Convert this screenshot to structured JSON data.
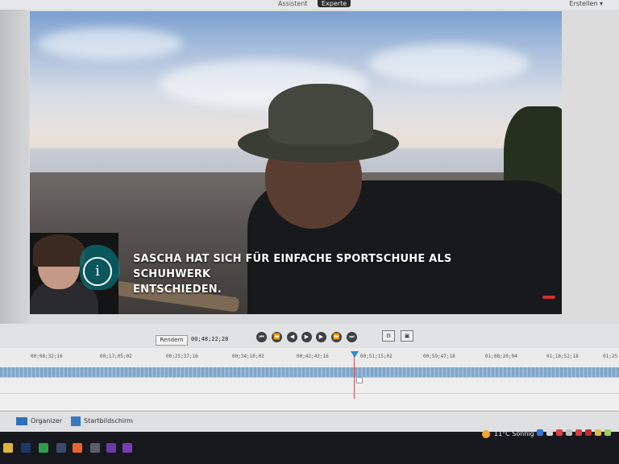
{
  "topbar": {
    "mode_quick": "Assistent",
    "mode_expert": "Experte",
    "create_label": "Erstellen ▾"
  },
  "preview": {
    "subtitle_line1": "SASCHA HAT SICH FÜR EINFACHE SPORTSCHUHE ALS SCHUHWERK",
    "subtitle_line2": "ENTSCHIEDEN.",
    "info_glyph": "i"
  },
  "transport": {
    "render_label": "Rendern",
    "timecode": "00;48;22;28",
    "buttons": [
      "⏮",
      "⏪",
      "◀",
      "▶",
      "▶",
      "⏩",
      "⏭"
    ],
    "aux_buttons": [
      "⚙",
      "▣"
    ]
  },
  "timeline": {
    "ruler_labels": [
      "00;08;32;16",
      "00;17;05;02",
      "00;25;37;16",
      "00;34;10;02",
      "00;42;42;16",
      "00;51;15;02",
      "00;59;47;18",
      "01;08;20;04",
      "01;16;52;18",
      "01;25"
    ]
  },
  "appbar": {
    "organizer_label": "Organizer",
    "home_label": "Startbildschirm"
  },
  "taskbar": {
    "weather_text": "11°C  Sonnig"
  }
}
